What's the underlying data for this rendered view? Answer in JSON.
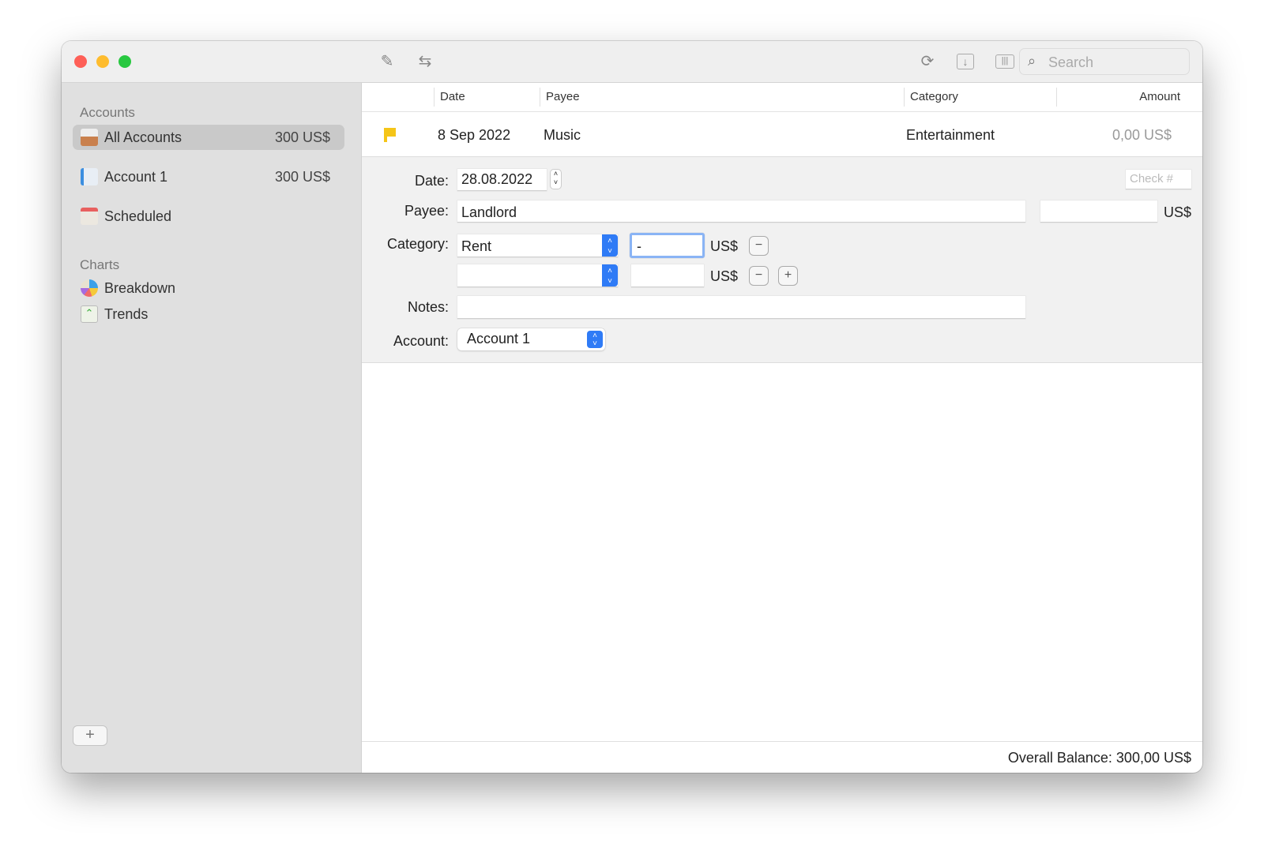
{
  "window": {
    "controls": {
      "close": "#fe5f57",
      "minimize": "#febc2e",
      "zoom": "#28c840"
    }
  },
  "toolbar": {
    "icons": [
      "compose-icon",
      "transfer-icon",
      "sync-icon",
      "import-icon",
      "columns-icon"
    ],
    "search_placeholder": "Search"
  },
  "sidebar": {
    "accounts_header": "Accounts",
    "items": [
      {
        "label": "All Accounts",
        "value": "300 US$",
        "icon": "inbox-tray-icon",
        "selected": true
      },
      {
        "label": "Account 1",
        "value": "300 US$",
        "icon": "ledger-pencil-icon"
      },
      {
        "label": "Scheduled",
        "value": "",
        "icon": "calendar-icon"
      }
    ],
    "charts_header": "Charts",
    "charts": [
      {
        "label": "Breakdown",
        "icon": "pie-chart-icon"
      },
      {
        "label": "Trends",
        "icon": "line-chart-icon"
      }
    ],
    "add_label": "+"
  },
  "table": {
    "columns": [
      "Date",
      "Payee",
      "Category",
      "Amount"
    ],
    "rows": [
      {
        "flag": "yellow-flag-icon",
        "date": "8 Sep 2022",
        "payee": "Music",
        "category": "Entertainment",
        "amount": "0,00 US$"
      }
    ]
  },
  "form": {
    "date_label": "Date:",
    "date_value": "28.08.2022",
    "check_placeholder": "Check #",
    "payee_label": "Payee:",
    "payee_value": "Landlord",
    "currency": "US$",
    "category_label": "Category:",
    "category_value": "Rent",
    "split_amount": "-",
    "minus": "−",
    "plus": "+",
    "notes_label": "Notes:",
    "notes_value": "",
    "account_label": "Account:",
    "account_value": "Account 1"
  },
  "footer": {
    "balance": "Overall Balance: 300,00 US$"
  },
  "colors": {
    "accent": "#2f7bf6",
    "flag": "#f5c518"
  }
}
